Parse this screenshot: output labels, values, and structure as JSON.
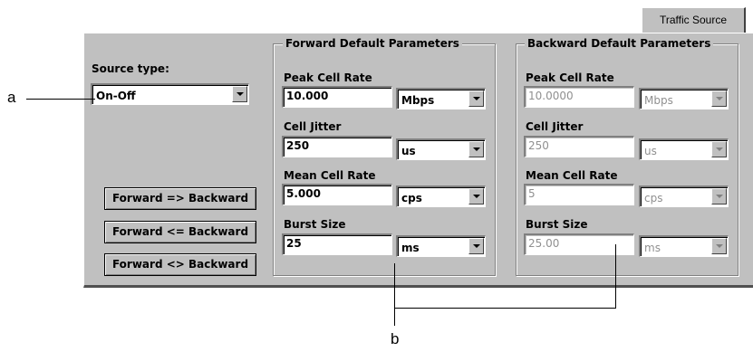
{
  "tab": {
    "label": "Traffic Source"
  },
  "source": {
    "label": "Source type:",
    "value": "On-Off"
  },
  "buttons": {
    "fwd_to_bwd": "Forward => Backward",
    "bwd_to_fwd": "Forward <= Backward",
    "swap": "Forward <> Backward"
  },
  "forward": {
    "title": "Forward Default Parameters",
    "peak_label": "Peak Cell Rate",
    "peak_value": "10.000",
    "peak_unit": "Mbps",
    "jitter_label": "Cell Jitter",
    "jitter_value": "250",
    "jitter_unit": "us",
    "mean_label": "Mean Cell Rate",
    "mean_value": "5.000",
    "mean_unit": "cps",
    "burst_label": "Burst Size",
    "burst_value": "25",
    "burst_unit": "ms"
  },
  "backward": {
    "title": "Backward Default Parameters",
    "peak_label": "Peak Cell Rate",
    "peak_value": "10.0000",
    "peak_unit": "Mbps",
    "jitter_label": "Cell Jitter",
    "jitter_value": "250",
    "jitter_unit": "us",
    "mean_label": "Mean Cell Rate",
    "mean_value": "5",
    "mean_unit": "cps",
    "burst_label": "Burst Size",
    "burst_value": "25.00",
    "burst_unit": "ms"
  },
  "annotations": {
    "a": "a",
    "b": "b"
  }
}
